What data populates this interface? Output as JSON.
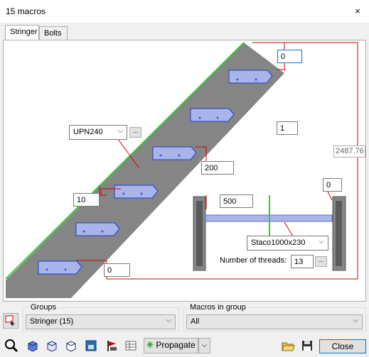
{
  "window": {
    "title": "15 macros",
    "close_glyph": "×"
  },
  "tabs": [
    {
      "label": "Stringer",
      "active": true
    },
    {
      "label": "Bolts",
      "active": false
    }
  ],
  "drawing": {
    "top_offset_value": "0",
    "count_value": "1",
    "profile_select": "UPN240",
    "profile_button": "...",
    "length_label": "2487.76",
    "right_offset_value": "0",
    "spacing_200": "200",
    "offset_10": "10",
    "detail_500": "500",
    "detail_select": "Staco1000x230",
    "threads_label": "Number of threads:",
    "threads_value": "13",
    "threads_button": "...",
    "bottom_value": "0"
  },
  "groups": {
    "label": "Groups",
    "value": "Stringer (15)"
  },
  "macros_in_group": {
    "label": "Macros in group",
    "value": "All"
  },
  "toolbar": {
    "propagate_label": "Propagate",
    "close_label": "Close"
  },
  "colors": {
    "stringer_fill": "#858585",
    "tread_fill": "#a8b4ea",
    "tread_stroke": "#1a3fc7",
    "dim_line": "#d40000",
    "green_edge": "#3cc83c",
    "focus": "#0078d7"
  }
}
